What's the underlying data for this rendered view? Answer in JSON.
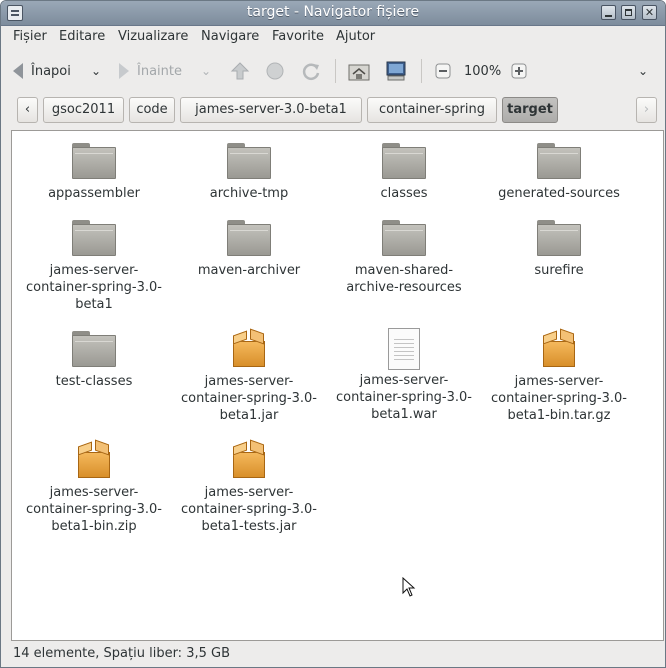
{
  "window": {
    "title": "target - Navigator fișiere"
  },
  "menubar": {
    "items": [
      "Fișier",
      "Editare",
      "Vizualizare",
      "Navigare",
      "Favorite",
      "Ajutor"
    ]
  },
  "toolbar": {
    "back_label": "Înapoi",
    "forward_label": "Înainte",
    "zoom_value": "100%"
  },
  "pathbar": {
    "crumbs": [
      "gsoc2011",
      "code",
      "james-server-3.0-beta1",
      "container-spring",
      "target"
    ],
    "active_crumb": "target"
  },
  "files": [
    {
      "type": "folder",
      "name": "appassembler"
    },
    {
      "type": "folder",
      "name": "archive-tmp"
    },
    {
      "type": "folder",
      "name": "classes"
    },
    {
      "type": "folder",
      "name": "generated-sources"
    },
    {
      "type": "folder",
      "name": "james-server-container-spring-3.0-beta1"
    },
    {
      "type": "folder",
      "name": "maven-archiver"
    },
    {
      "type": "folder",
      "name": "maven-shared-archive-resources"
    },
    {
      "type": "folder",
      "name": "surefire"
    },
    {
      "type": "folder",
      "name": "test-classes"
    },
    {
      "type": "package",
      "name": "james-server-container-spring-3.0-beta1.jar"
    },
    {
      "type": "document",
      "name": "james-server-container-spring-3.0-beta1.war"
    },
    {
      "type": "package",
      "name": "james-server-container-spring-3.0-beta1-bin.tar.gz"
    },
    {
      "type": "package",
      "name": "james-server-container-spring-3.0-beta1-bin.zip"
    },
    {
      "type": "package",
      "name": "james-server-container-spring-3.0-beta1-tests.jar"
    }
  ],
  "files_display": [
    "appassembler",
    "archive-tmp",
    "classes",
    "generated-sources",
    "james-server-\ncontainer-spring-3.0-\nbeta1",
    "maven-archiver",
    "maven-shared-\narchive-resources",
    "surefire",
    "test-classes",
    "james-server-\ncontainer-spring-3.0-\nbeta1.jar",
    "james-server-\ncontainer-spring-3.0-\nbeta1.war",
    "james-server-\ncontainer-spring-3.0-\nbeta1-bin.tar.gz",
    "james-server-\ncontainer-spring-3.0-\nbeta1-bin.zip",
    "james-server-\ncontainer-spring-3.0-\nbeta1-tests.jar"
  ],
  "statusbar": {
    "text": "14 elemente, Spațiu liber: 3,5 GB"
  },
  "colors": {
    "titlebar": "#8c9aaa",
    "folder": "#aeada7",
    "package": "#e9a443"
  }
}
